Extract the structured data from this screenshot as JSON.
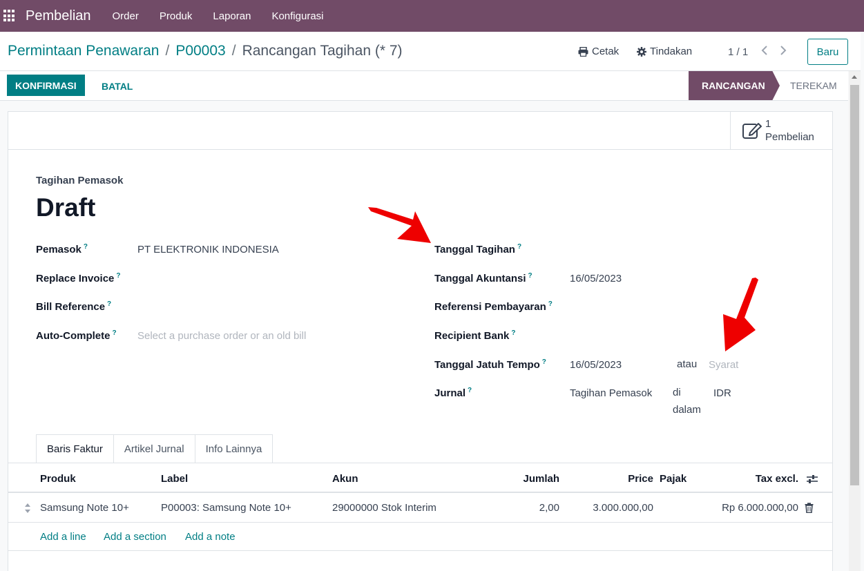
{
  "navbar": {
    "app_name": "Pembelian",
    "menu": [
      "Order",
      "Produk",
      "Laporan",
      "Konfigurasi"
    ]
  },
  "control": {
    "breadcrumb": [
      "Permintaan Penawaran",
      "P00003",
      "Rancangan Tagihan (* 7)"
    ],
    "print_label": "Cetak",
    "action_label": "Tindakan",
    "pager": "1 / 1",
    "new_label": "Baru"
  },
  "statusbar": {
    "confirm_label": "KONFIRMASI",
    "cancel_label": "BATAL",
    "stage_active": "RANCANGAN",
    "stage_next": "TEREKAM"
  },
  "smart_button": {
    "count": "1",
    "label": "Pembelian"
  },
  "form": {
    "doc_type": "Tagihan Pemasok",
    "title": "Draft",
    "left": {
      "vendor_label": "Pemasok",
      "vendor_value": "PT ELEKTRONIK INDONESIA",
      "replace_label": "Replace Invoice",
      "billref_label": "Bill Reference",
      "autocomplete_label": "Auto-Complete",
      "autocomplete_placeholder": "Select a purchase order or an old bill"
    },
    "right": {
      "bill_date_label": "Tanggal Tagihan",
      "acc_date_label": "Tanggal Akuntansi",
      "acc_date_value": "16/05/2023",
      "payment_ref_label": "Referensi Pembayaran",
      "recipient_bank_label": "Recipient Bank",
      "due_date_label": "Tanggal Jatuh Tempo",
      "due_date_value": "16/05/2023",
      "or_label": "atau",
      "terms_placeholder": "Syarat",
      "journal_label": "Jurnal",
      "journal_value": "Tagihan Pemasok",
      "in_label_1": "di",
      "in_label_2": "dalam",
      "currency_value": "IDR"
    },
    "help_mark": "?"
  },
  "tabs": [
    "Baris Faktur",
    "Artikel Jurnal",
    "Info Lainnya"
  ],
  "table": {
    "headers": {
      "product": "Produk",
      "label": "Label",
      "account": "Akun",
      "quantity": "Jumlah",
      "price": "Price",
      "tax": "Pajak",
      "subtotal": "Tax excl."
    },
    "rows": [
      {
        "product": "Samsung Note 10+",
        "label": "P00003: Samsung Note 10+",
        "account": "29000000 Stok Interim",
        "quantity": "2,00",
        "price": "3.000.000,00",
        "subtotal": "Rp 6.000.000,00"
      }
    ],
    "add_line": "Add a line",
    "add_section": "Add a section",
    "add_note": "Add a note"
  },
  "colors": {
    "brand": "#714b67",
    "accent": "#017e84",
    "arrow": "#ee0000"
  },
  "icons": [
    "apps-grid-icon",
    "printer-icon",
    "gear-icon",
    "chevron-left-icon",
    "chevron-right-icon",
    "edit-document-icon",
    "drag-handle-icon",
    "trash-icon",
    "column-settings-icon",
    "red-arrow-annotation"
  ]
}
